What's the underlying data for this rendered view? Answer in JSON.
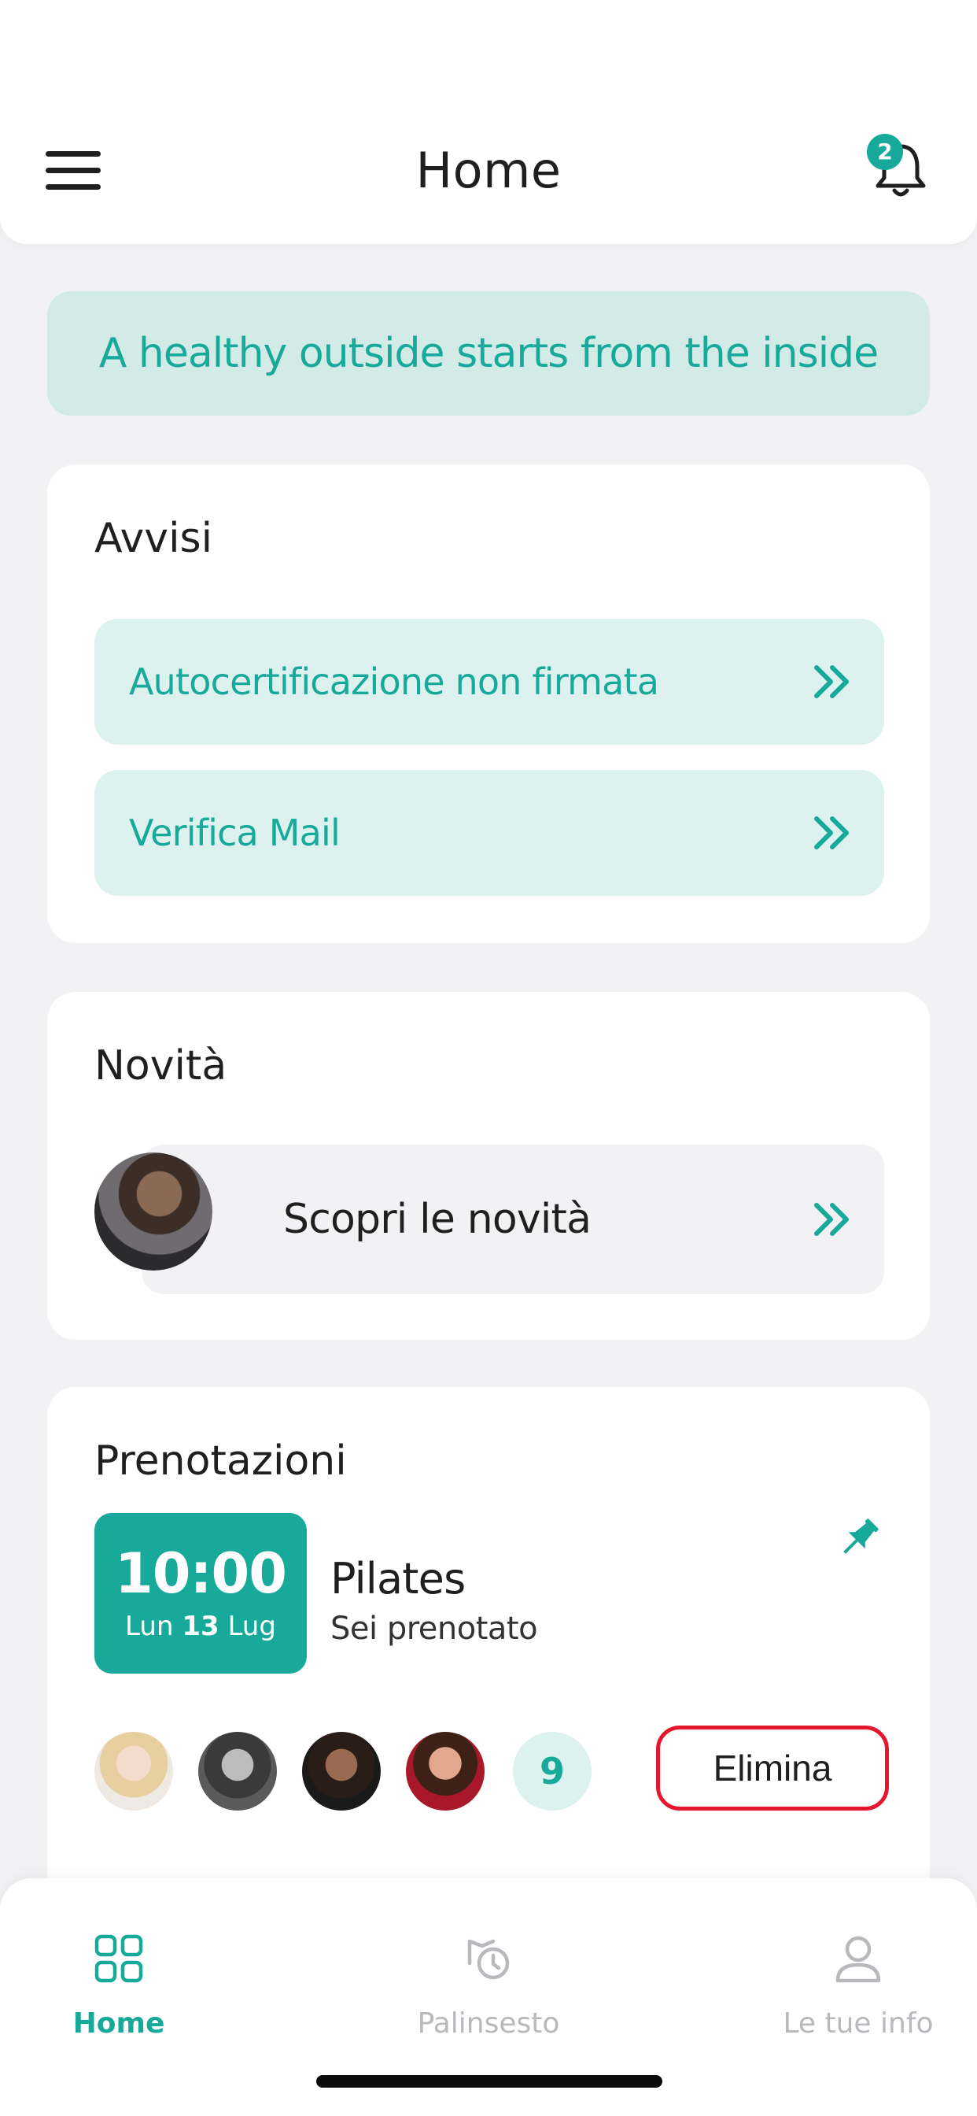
{
  "header": {
    "title": "Home",
    "notifications_count": "2"
  },
  "tagline": "A healthy outside starts from the inside",
  "alerts": {
    "title": "Avvisi",
    "items": [
      {
        "label": "Autocertificazione non firmata",
        "icon": "double-chevron-right-icon"
      },
      {
        "label": "Verifica Mail",
        "icon": "double-chevron-right-icon"
      }
    ]
  },
  "news": {
    "title": "Novità",
    "link_label": "Scopri le novità"
  },
  "bookings": {
    "title": "Prenotazioni",
    "time": "10:00",
    "date_day": "Lun",
    "date_num": "13",
    "date_month": "Lug",
    "class_name": "Pilates",
    "status": "Sei prenotato",
    "more_attendees": "9",
    "delete_label": "Elimina"
  },
  "tabbar": {
    "tabs": [
      {
        "label": "Home",
        "icon": "grid-icon",
        "active": true
      },
      {
        "label": "Palinsesto",
        "icon": "history-icon",
        "active": false
      },
      {
        "label": "Le tue info",
        "icon": "user-icon",
        "active": false
      }
    ]
  },
  "colors": {
    "accent": "#17a999",
    "accent_light": "#ddf1ee",
    "tagline_bg": "#d3ebe7",
    "danger": "#e5172f",
    "inactive": "#b8b8bd",
    "background": "#f2f2f4"
  }
}
